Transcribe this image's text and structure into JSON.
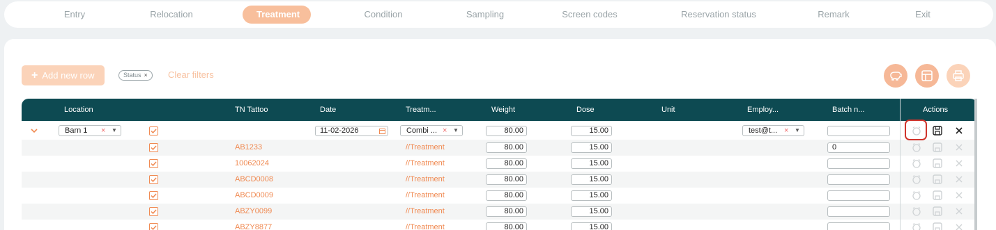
{
  "nav": {
    "tabs": [
      {
        "label": "Entry"
      },
      {
        "label": "Relocation"
      },
      {
        "label": "Treatment",
        "active": true
      },
      {
        "label": "Condition"
      },
      {
        "label": "Sampling"
      },
      {
        "label": "Screen codes"
      },
      {
        "label": "Reservation status"
      },
      {
        "label": "Remark"
      },
      {
        "label": "Exit"
      }
    ]
  },
  "toolbar": {
    "add_row_label": "Add new row",
    "filter_chip": "Status",
    "clear_filters": "Clear filters"
  },
  "table": {
    "columns": [
      "Location",
      "TN Tattoo",
      "Date",
      "Treatm...",
      "Weight",
      "Dose",
      "Unit",
      "Employ...",
      "Batch n...",
      "Actions"
    ],
    "edit_row": {
      "location": "Barn 1",
      "date": "11-02-2026",
      "treatment": "Combi ...",
      "weight": "80.00",
      "dose": "15.00",
      "employee": "test@t...",
      "batch": ""
    },
    "rows": [
      {
        "tattoo": "AB1233",
        "treatment": "//Treatment",
        "weight": "80.00",
        "dose": "15.00",
        "batch": "0"
      },
      {
        "tattoo": "10062024",
        "treatment": "//Treatment",
        "weight": "80.00",
        "dose": "15.00",
        "batch": ""
      },
      {
        "tattoo": "ABCD0008",
        "treatment": "//Treatment",
        "weight": "80.00",
        "dose": "15.00",
        "batch": ""
      },
      {
        "tattoo": "ABCD0009",
        "treatment": "//Treatment",
        "weight": "80.00",
        "dose": "15.00",
        "batch": ""
      },
      {
        "tattoo": "ABZY0099",
        "treatment": "//Treatment",
        "weight": "80.00",
        "dose": "15.00",
        "batch": ""
      },
      {
        "tattoo": "ABZY8877",
        "treatment": "//Treatment",
        "weight": "80.00",
        "dose": "15.00",
        "batch": ""
      }
    ]
  },
  "colors": {
    "accent": "#f08a52",
    "header_bg": "#0d4a52",
    "active_tab": "#f8bf9c"
  }
}
